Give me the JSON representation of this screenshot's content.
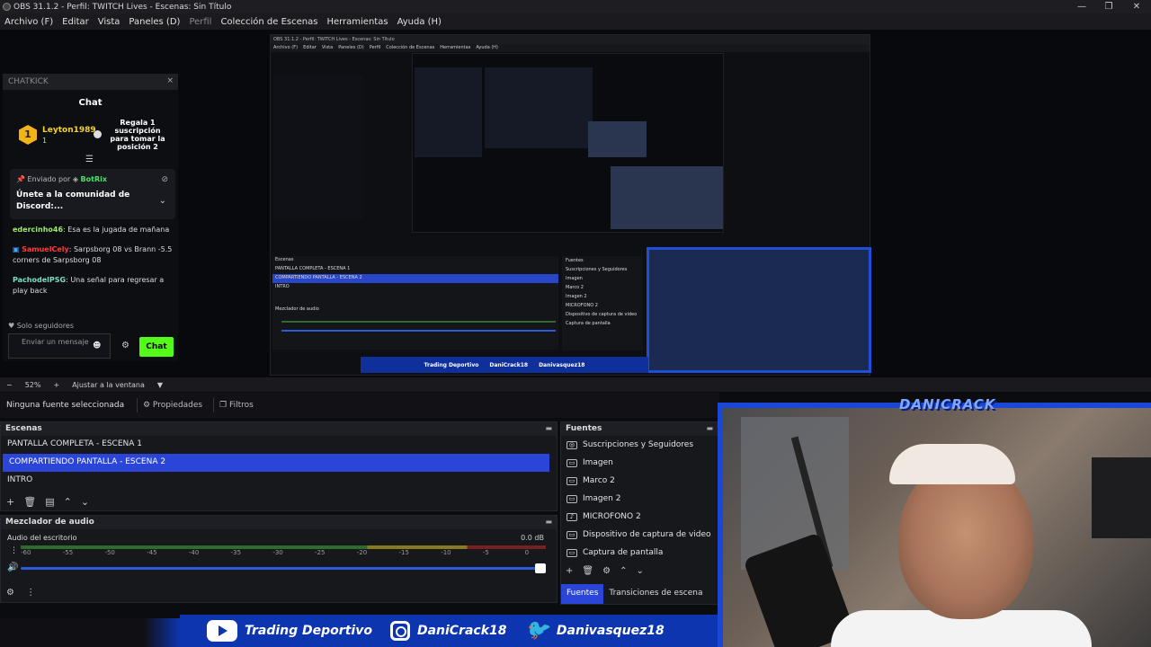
{
  "titlebar": {
    "title": "OBS 31.1.2 - Perfil: TWITCH Lives - Escenas: Sin Título",
    "min": "—",
    "restore": "❐",
    "close": "✕"
  },
  "menu": {
    "items": [
      "Archivo (F)",
      "Editar",
      "Vista",
      "Paneles (D)",
      "Perfil",
      "Colección de Escenas",
      "Herramientas",
      "Ayuda (H)"
    ]
  },
  "chat": {
    "dock_title": "CHATKICK",
    "close": "×",
    "title": "Chat",
    "gift_user": "Leyton1989",
    "gift_count": "1",
    "gift_badge": "1",
    "gift_message": "Regala 1 suscripción para tomar la posición 2",
    "filter_icon": "☰",
    "pinned_by": "Enviado por",
    "pinned_bot": "BotRix",
    "pinned_text": "Únete a la comunidad de Discord:...",
    "chevron": "⌄",
    "messages": [
      {
        "user": "edercinho46",
        "text": ": Esa es la jugada de mañana"
      },
      {
        "user": "SamuelCely",
        "text": ": Sarpsborg 08 vs Brann -5.5 corners de Sarpsborg 08"
      },
      {
        "user": "PachodelPSG",
        "text": ": Una señal para regresar a play back"
      }
    ],
    "followers": "♥ Solo seguidores",
    "input_placeholder": "Enviar un mensaje",
    "send_label": "Chat"
  },
  "nested": {
    "title": "OBS 31.1.2 - Perfil: TWITCH Lives - Escenas: Sin Título",
    "menu": [
      "Archivo (F)",
      "Editar",
      "Vista",
      "Paneles (D)",
      "Perfil",
      "Colección de Escenas",
      "Herramientas",
      "Ayuda (H)"
    ],
    "scenes_title": "Escenas",
    "scenes": [
      "PANTALLA COMPLETA - ESCENA 1",
      "COMPARTIENDO PANTALLA - ESCENA 2",
      "INTRO"
    ],
    "mixer_title": "Mezclador de audio",
    "sources_title": "Fuentes",
    "sources": [
      "Suscripciones y Seguidores",
      "Imagen",
      "Marco 2",
      "Imagen 2",
      "MICROFONO 2",
      "Dispositivo de captura de video",
      "Captura de pantalla"
    ],
    "banner": [
      "Trading Deportivo",
      "DaniCrack18",
      "Danivasquez18"
    ]
  },
  "zoom": {
    "minus": "−",
    "value": "52%",
    "plus": "+",
    "fit": "Ajustar a la ventana",
    "arrow": "▼"
  },
  "context": {
    "no_source": "Ninguna fuente seleccionada",
    "properties": "⚙ Propiedades",
    "filters": "❐ Filtros"
  },
  "scenes": {
    "title": "Escenas",
    "menu": "▬",
    "items": [
      "PANTALLA COMPLETA - ESCENA 1",
      "COMPARTIENDO PANTALLA - ESCENA 2",
      "INTRO"
    ],
    "selected_index": 1,
    "tools": [
      "+",
      "🗑",
      "▤",
      "⌃",
      "⌄"
    ]
  },
  "mixer": {
    "title": "Mezclador de audio",
    "menu": "▬",
    "track_label": "Audio del escritorio",
    "db_value": "0.0 dB",
    "ticks": [
      "-60",
      "-55",
      "-50",
      "-45",
      "-40",
      "-35",
      "-30",
      "-25",
      "-20",
      "-15",
      "-10",
      "-5",
      "0"
    ],
    "volume_level": 1.0
  },
  "sources": {
    "title": "Fuentes",
    "menu": "▬",
    "items": [
      {
        "label": "Suscripciones y Seguidores",
        "icon": "globe-icon"
      },
      {
        "label": "Imagen",
        "icon": "image-icon"
      },
      {
        "label": "Marco 2",
        "icon": "image-icon"
      },
      {
        "label": "Imagen 2",
        "icon": "image-icon"
      },
      {
        "label": "MICROFONO 2",
        "icon": "microphone-icon"
      },
      {
        "label": "Dispositivo de captura de video",
        "icon": "camera-icon"
      },
      {
        "label": "Captura de pantalla",
        "icon": "monitor-icon"
      }
    ],
    "tools": [
      "+",
      "🗑",
      "⚙",
      "⌃",
      "⌄"
    ],
    "tab_sources": "Fuentes",
    "tab_transitions": "Transiciones de escena"
  },
  "overlay": {
    "cam_title": "DANICRACK",
    "banner": [
      {
        "icon": "youtube-icon",
        "label": "Trading Deportivo"
      },
      {
        "icon": "instagram-icon",
        "label": "DaniCrack18"
      },
      {
        "icon": "twitter-icon",
        "label": "Danivasquez18"
      }
    ]
  },
  "colors": {
    "accent": "#2b45d8",
    "kick_green": "#53fc18",
    "brand_blue": "#0d35b0"
  }
}
